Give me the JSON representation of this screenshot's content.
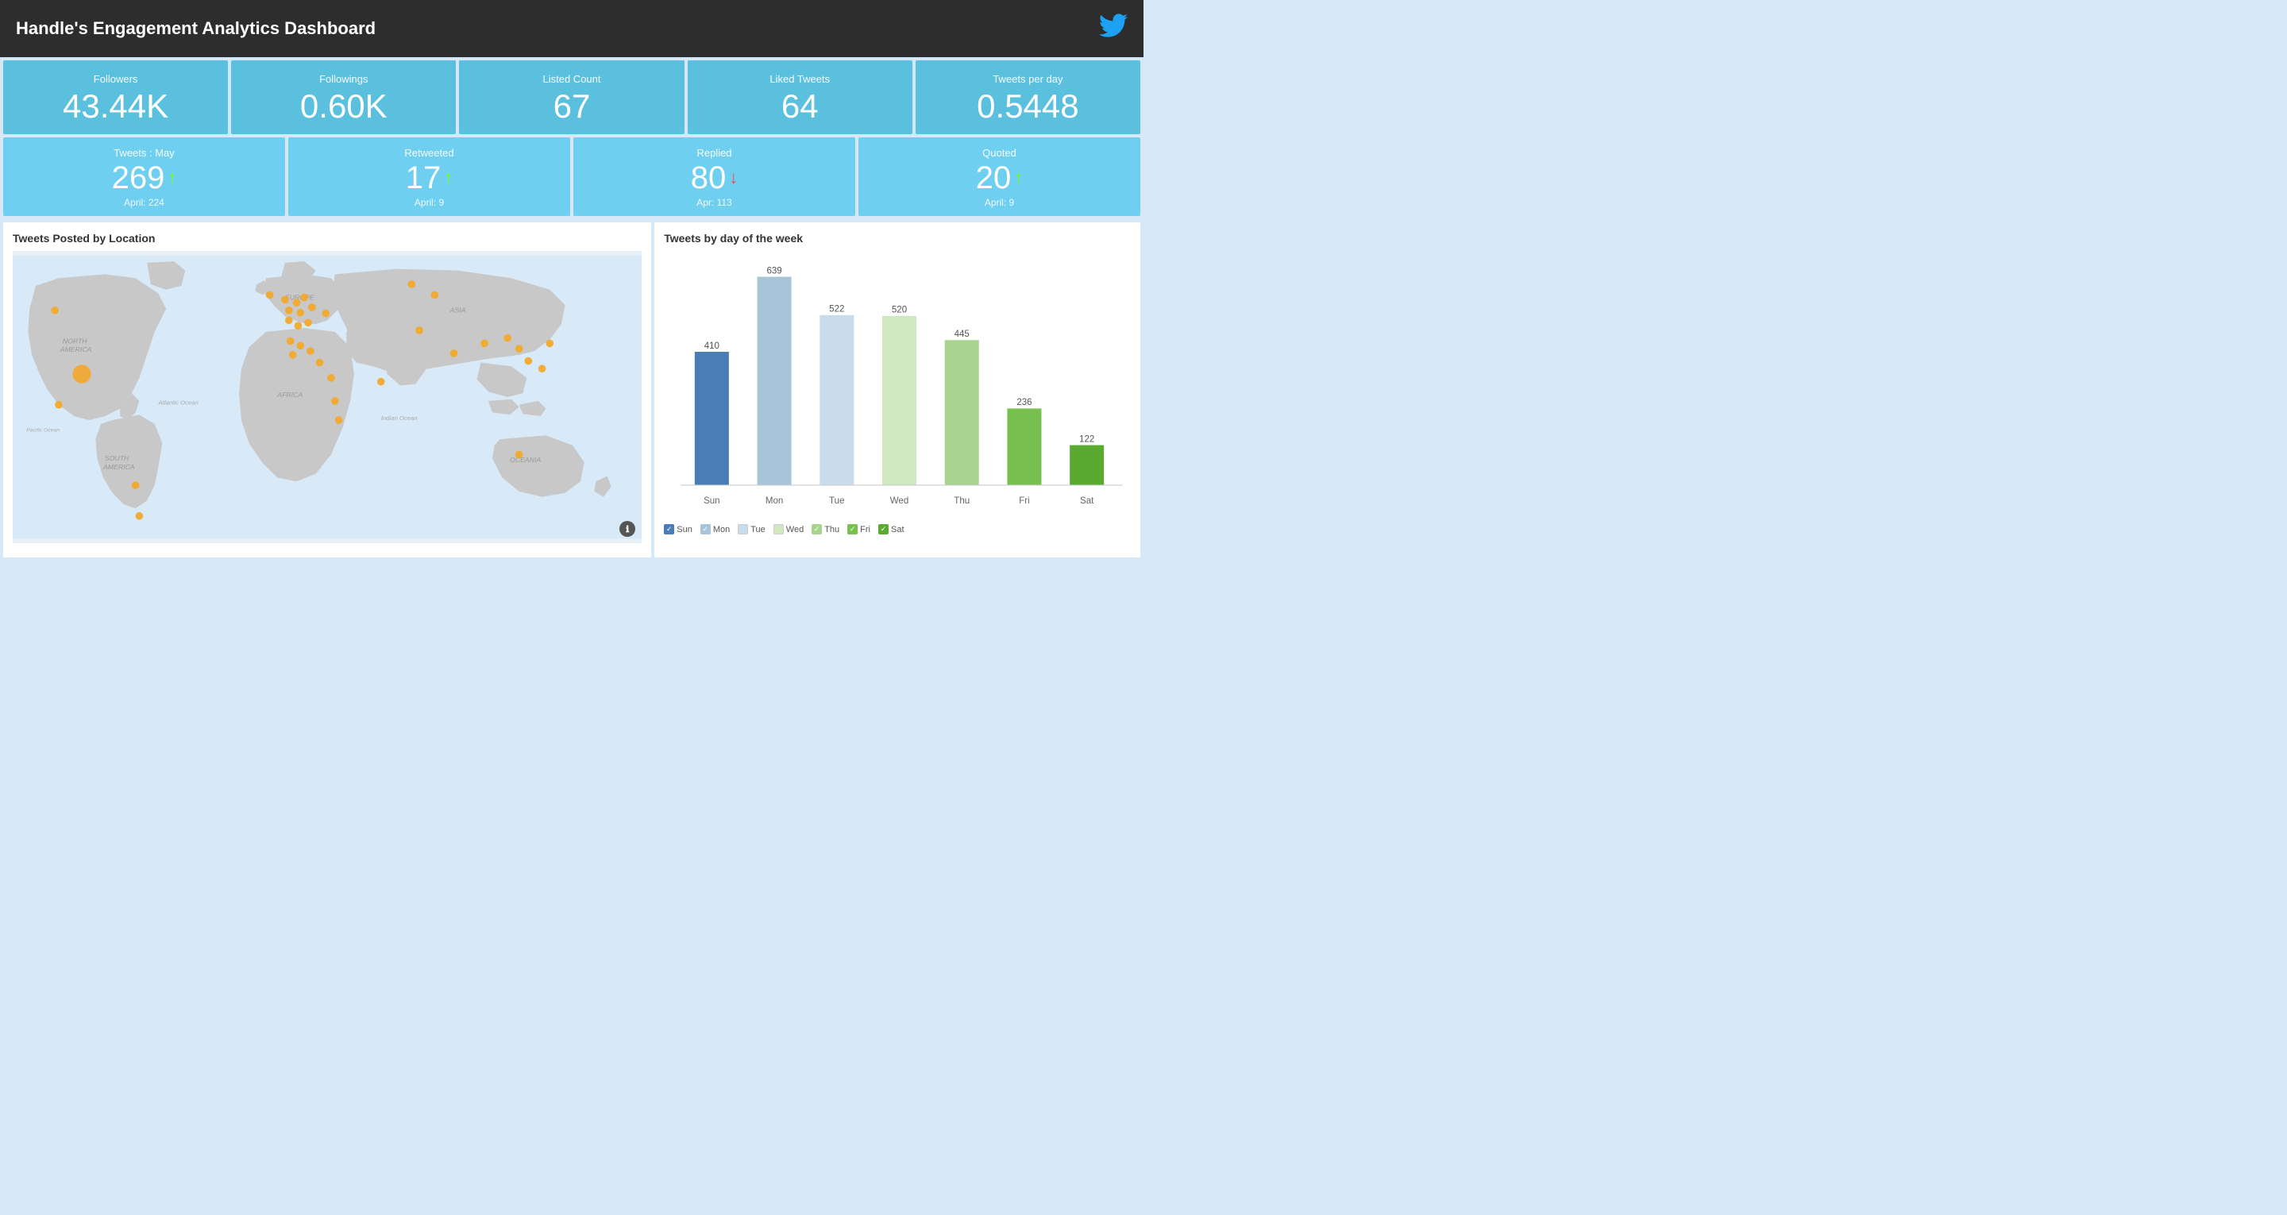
{
  "header": {
    "title": "Handle's Engagement Analytics Dashboard",
    "twitter_icon": "🐦"
  },
  "row1_cards": [
    {
      "label": "Followers",
      "value": "43.44K"
    },
    {
      "label": "Followings",
      "value": "0.60K"
    },
    {
      "label": "Listed Count",
      "value": "67"
    },
    {
      "label": "Liked Tweets",
      "value": "64"
    },
    {
      "label": "Tweets per day",
      "value": "0.5448"
    }
  ],
  "row2_cards": [
    {
      "label": "Tweets : May",
      "value": "269",
      "arrow": "up",
      "sub": "April: 224"
    },
    {
      "label": "Retweeted",
      "value": "17",
      "arrow": "up",
      "sub": "April: 9"
    },
    {
      "label": "Replied",
      "value": "80",
      "arrow": "down",
      "sub": "Apr: 113"
    },
    {
      "label": "Quoted",
      "value": "20",
      "arrow": "up",
      "sub": "April: 9"
    }
  ],
  "map_panel": {
    "title": "Tweets Posted by Location",
    "labels": [
      "NORTH AMERICA",
      "SOUTH AMERICA",
      "EUROPE",
      "AFRICA",
      "ASIA",
      "OCEANIA",
      "Atlantic Ocean",
      "Indian Ocean",
      "Pacific Ocean"
    ]
  },
  "chart_panel": {
    "title": "Tweets by day of the week",
    "bars": [
      {
        "day": "Sun",
        "value": 410,
        "color": "#4a7db5"
      },
      {
        "day": "Mon",
        "value": 639,
        "color": "#a8c4d8"
      },
      {
        "day": "Tue",
        "value": 522,
        "color": "#c8dcec"
      },
      {
        "day": "Wed",
        "value": 520,
        "color": "#d0e8c0"
      },
      {
        "day": "Thu",
        "value": 445,
        "color": "#a8d490"
      },
      {
        "day": "Fri",
        "value": 236,
        "color": "#78c050"
      },
      {
        "day": "Sat",
        "value": 122,
        "color": "#5aaa30"
      }
    ],
    "legend": [
      {
        "label": "Sun",
        "color": "#4a7db5",
        "checked": true
      },
      {
        "label": "Mon",
        "color": "#a8c4d8",
        "checked": true,
        "light": true
      },
      {
        "label": "Tue",
        "color": "#c8dcec",
        "checked": false
      },
      {
        "label": "Wed",
        "color": "#d0e8c0",
        "checked": false
      },
      {
        "label": "Thu",
        "color": "#a8d490",
        "checked": true
      },
      {
        "label": "Fri",
        "color": "#78c050",
        "checked": true
      },
      {
        "label": "Sat",
        "color": "#5aaa30",
        "checked": true
      }
    ]
  }
}
